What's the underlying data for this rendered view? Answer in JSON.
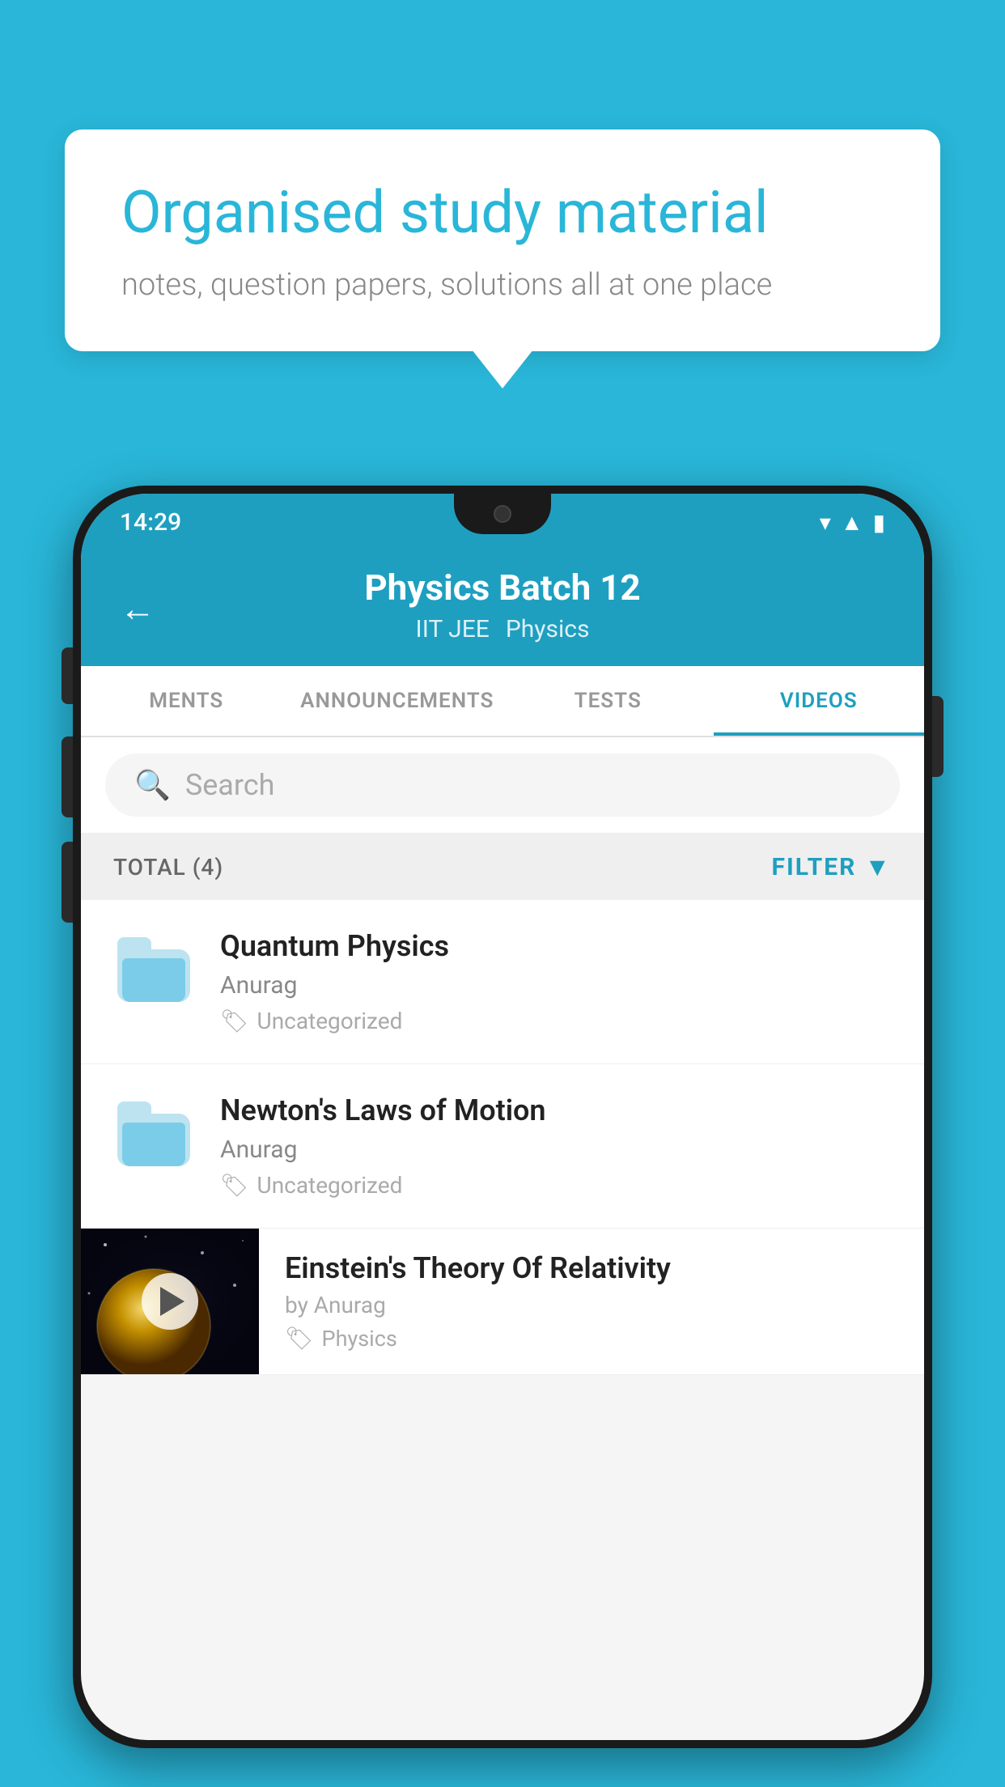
{
  "page": {
    "background_color": "#29b6d8"
  },
  "speech_bubble": {
    "title": "Organised study material",
    "subtitle": "notes, question papers, solutions all at one place"
  },
  "phone": {
    "status_bar": {
      "time": "14:29"
    },
    "header": {
      "back_label": "←",
      "title": "Physics Batch 12",
      "subtitle_left": "IIT JEE",
      "subtitle_right": "Physics"
    },
    "tabs": [
      {
        "label": "MENTS",
        "active": false
      },
      {
        "label": "ANNOUNCEMENTS",
        "active": false
      },
      {
        "label": "TESTS",
        "active": false
      },
      {
        "label": "VIDEOS",
        "active": true
      }
    ],
    "search": {
      "placeholder": "Search"
    },
    "filter_bar": {
      "total_label": "TOTAL (4)",
      "filter_label": "FILTER"
    },
    "videos": [
      {
        "title": "Quantum Physics",
        "author": "Anurag",
        "tag": "Uncategorized",
        "has_thumbnail": false
      },
      {
        "title": "Newton's Laws of Motion",
        "author": "Anurag",
        "tag": "Uncategorized",
        "has_thumbnail": false
      },
      {
        "title": "Einstein's Theory Of Relativity",
        "author": "by Anurag",
        "tag": "Physics",
        "has_thumbnail": true
      }
    ]
  }
}
